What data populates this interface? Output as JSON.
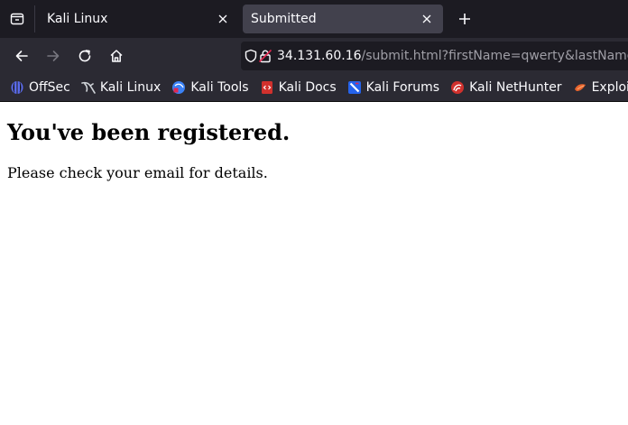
{
  "browser": {
    "tabs": [
      {
        "title": "Kali Linux",
        "active": false
      },
      {
        "title": "Submitted",
        "active": true
      }
    ],
    "url": {
      "host": "34.131.60.16",
      "rest": "/submit.html?firstName=qwerty&lastName="
    },
    "bookmarks": [
      {
        "label": "OffSec",
        "icon": "offsec-icon",
        "color": "#5b6cf0"
      },
      {
        "label": "Kali Linux",
        "icon": "kali-dragon-icon",
        "color": "#cfd3d8"
      },
      {
        "label": "Kali Tools",
        "icon": "kali-tools-icon",
        "color": "#3b82f6"
      },
      {
        "label": "Kali Docs",
        "icon": "kali-docs-icon",
        "color": "#d0312d"
      },
      {
        "label": "Kali Forums",
        "icon": "kali-forums-icon",
        "color": "#2563eb"
      },
      {
        "label": "Kali NetHunter",
        "icon": "nethunter-icon",
        "color": "#d0312d"
      },
      {
        "label": "Exploit-DB",
        "icon": "exploit-db-icon",
        "color": "#e8642d"
      }
    ]
  },
  "page": {
    "heading": "You've been registered.",
    "message": "Please check your email for details."
  }
}
